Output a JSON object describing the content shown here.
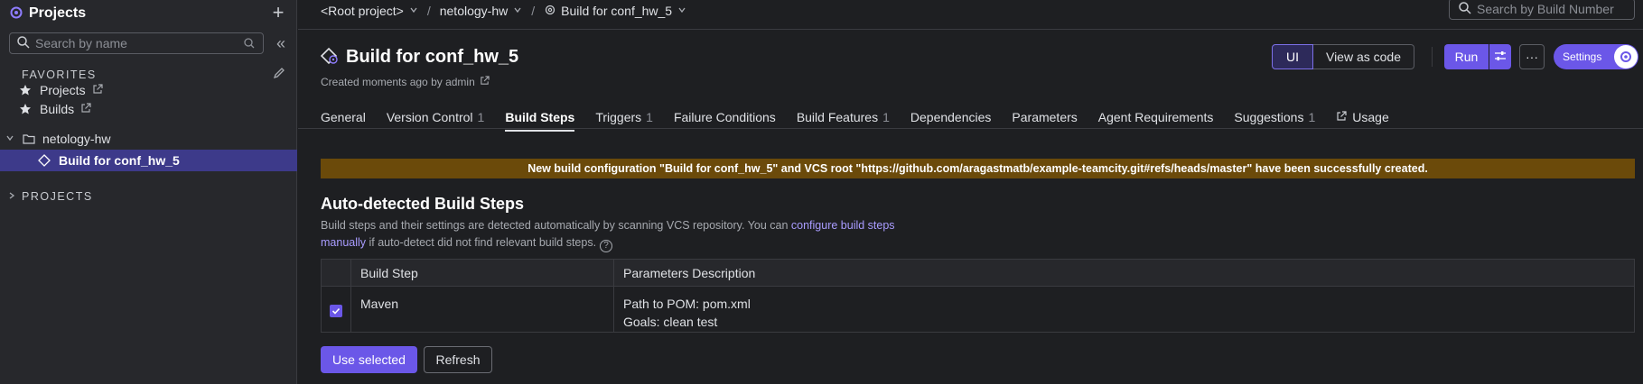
{
  "sidebar": {
    "title": "Projects",
    "search_placeholder": "Search by name",
    "favorites_header": "FAVORITES",
    "favorites": [
      {
        "label": "Projects",
        "icon": "star-icon"
      },
      {
        "label": "Builds",
        "icon": "star-icon"
      }
    ],
    "tree": [
      {
        "label": "netology-hw",
        "icon": "folder-icon"
      },
      {
        "label": "Build for conf_hw_5",
        "icon": "build-config-icon"
      }
    ],
    "projects_header": "PROJECTS"
  },
  "breadcrumbs": [
    {
      "label": "<Root project>"
    },
    {
      "label": "netology-hw"
    },
    {
      "label": "Build for conf_hw_5"
    }
  ],
  "build_search_placeholder": "Search by Build Number",
  "page": {
    "title": "Build for conf_hw_5",
    "meta": "Created moments ago by admin"
  },
  "toolbar": {
    "ui_label": "UI",
    "view_as_code_label": "View as code",
    "run_label": "Run",
    "more_label": "···",
    "settings_label": "Settings"
  },
  "tabs": [
    {
      "label": "General",
      "count": ""
    },
    {
      "label": "Version Control",
      "count": "1"
    },
    {
      "label": "Build Steps",
      "count": ""
    },
    {
      "label": "Triggers",
      "count": "1"
    },
    {
      "label": "Failure Conditions",
      "count": ""
    },
    {
      "label": "Build Features",
      "count": "1"
    },
    {
      "label": "Dependencies",
      "count": ""
    },
    {
      "label": "Parameters",
      "count": ""
    },
    {
      "label": "Agent Requirements",
      "count": ""
    },
    {
      "label": "Suggestions",
      "count": "1"
    },
    {
      "label": "Usage",
      "count": ""
    }
  ],
  "active_tab": "Build Steps",
  "banner": "New build configuration \"Build for conf_hw_5\" and VCS root \"https://github.com/aragastmatb/example-teamcity.git#refs/heads/master\" have been successfully created.",
  "section": {
    "title": "Auto-detected Build Steps",
    "desc_before": "Build steps and their settings are detected automatically by scanning VCS repository. You can ",
    "desc_link1": "configure build steps",
    "desc_link2": "manually",
    "desc_after": " if auto-detect did not find relevant build steps."
  },
  "table": {
    "headers": [
      "Build Step",
      "Parameters Description"
    ],
    "rows": [
      {
        "checked": true,
        "step": "Maven",
        "params": [
          "Path to POM: pom.xml",
          "Goals: clean test"
        ]
      }
    ]
  },
  "actions": {
    "use_selected_label": "Use selected",
    "refresh_label": "Refresh"
  },
  "colors": {
    "accent": "#6b57e8",
    "banner_bg": "#6b4a0a",
    "sidebar_active": "#3d3a8a",
    "link": "#a99cff"
  }
}
